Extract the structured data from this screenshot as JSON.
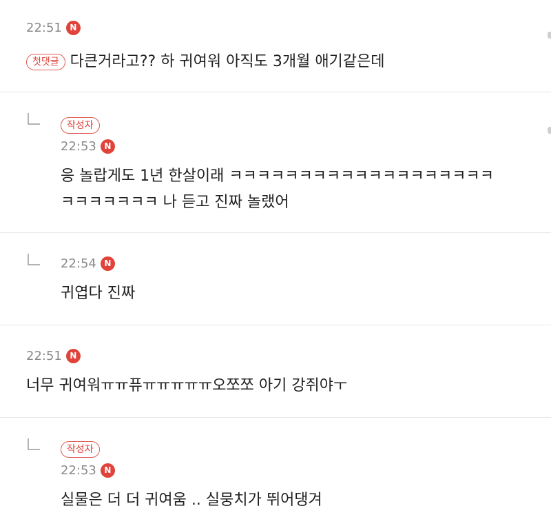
{
  "comments": [
    {
      "time": "22:51",
      "badge": "N",
      "tag": "첫댓글",
      "text": "다큰거라고?? 하 귀여워 아직도 3개월 애기같은데"
    },
    {
      "time": "22:53",
      "badge": "N",
      "tag": "작성자",
      "line1": "응 놀랍게도 1년 한살이래 ㅋㅋㅋㅋㅋㅋㅋㅋㅋㅋㅋㅋㅋㅋㅋㅋㅋㅋㅋ",
      "line2": "ㅋㅋㅋㅋㅋㅋㅋ 나 듣고 진짜 놀랬어"
    },
    {
      "time": "22:54",
      "badge": "N",
      "text": "귀엽다 진짜"
    },
    {
      "time": "22:51",
      "badge": "N",
      "text": "너무 귀여워ㅠㅠ퓨ㅠㅠㅠㅠㅠ오쪼쪼 아기 강쥐야ㅜ"
    },
    {
      "time": "22:53",
      "badge": "N",
      "tag": "작성자",
      "text": "실물은 더 더 귀여움 .. 실뭉치가 뛰어댕겨"
    }
  ]
}
